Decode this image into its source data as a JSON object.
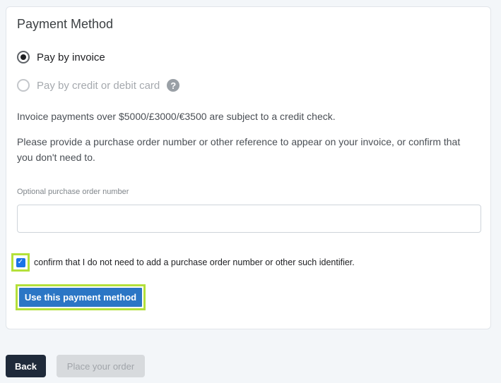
{
  "payment": {
    "title": "Payment Method",
    "options": [
      {
        "label": "Pay by invoice",
        "selected": true,
        "disabled": false
      },
      {
        "label": "Pay by credit or debit card",
        "selected": false,
        "disabled": true
      }
    ],
    "help_icon": "?",
    "info_credit_check": "Invoice payments over $5000/£3000/€3500 are subject to a credit check.",
    "info_po_reference": "Please provide a purchase order number or other reference to appear on your invoice, or confirm that you don't need to.",
    "po_field": {
      "label": "Optional purchase order number",
      "value": "",
      "placeholder": ""
    },
    "confirm": {
      "checked": true,
      "check_glyph": "✓",
      "label": "confirm that I do not need to add a purchase order number or other such identifier."
    },
    "use_method_button": "Use this payment method"
  },
  "footer": {
    "back_button": "Back",
    "place_order_button": "Place your order"
  },
  "colors": {
    "primary_button": "#2b76c5",
    "highlight_outline": "#b4e03a",
    "back_button": "#1f2a3a",
    "disabled_button": "#d7dadd"
  }
}
